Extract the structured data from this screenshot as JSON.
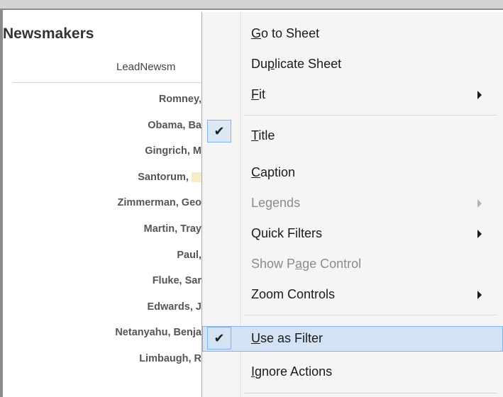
{
  "sheet": {
    "title": "Newsmakers",
    "column_header": "LeadNewsm",
    "rows": [
      "Romney,",
      "Obama, Ba",
      "Gingrich, M",
      "Santorum,",
      "Zimmerman, Geo",
      "Martin, Tray",
      "Paul,",
      "Fluke, Sar",
      "Edwards, J",
      "Netanyahu, Benja",
      "Limbaugh, R"
    ]
  },
  "context_menu": {
    "items": [
      {
        "label": "Go to Sheet",
        "mnemonic": "G"
      },
      {
        "label": "Duplicate Sheet",
        "mnemonic": "p"
      },
      {
        "label": "Fit",
        "mnemonic": "F",
        "submenu": true
      },
      {
        "label": "Title",
        "mnemonic": "T",
        "checked": true
      },
      {
        "label": "Caption",
        "mnemonic": "C"
      },
      {
        "label": "Legends",
        "disabled": true,
        "submenu": true
      },
      {
        "label": "Quick Filters",
        "submenu": true
      },
      {
        "label": "Show Page Control",
        "mnemonic": "a",
        "disabled": true
      },
      {
        "label": "Zoom Controls",
        "submenu": true
      },
      {
        "label": "Use as Filter",
        "mnemonic": "U",
        "checked": true,
        "highlighted": true
      },
      {
        "label": "Ignore Actions",
        "mnemonic": "I"
      }
    ]
  },
  "icons": {
    "checkmark": "checkmark-icon",
    "submenu_arrow": "submenu-arrow-icon"
  },
  "colors": {
    "highlight": "#d3e3f5",
    "highlight_border": "#7eb4ea",
    "disabled_text": "#8c8c8c"
  }
}
